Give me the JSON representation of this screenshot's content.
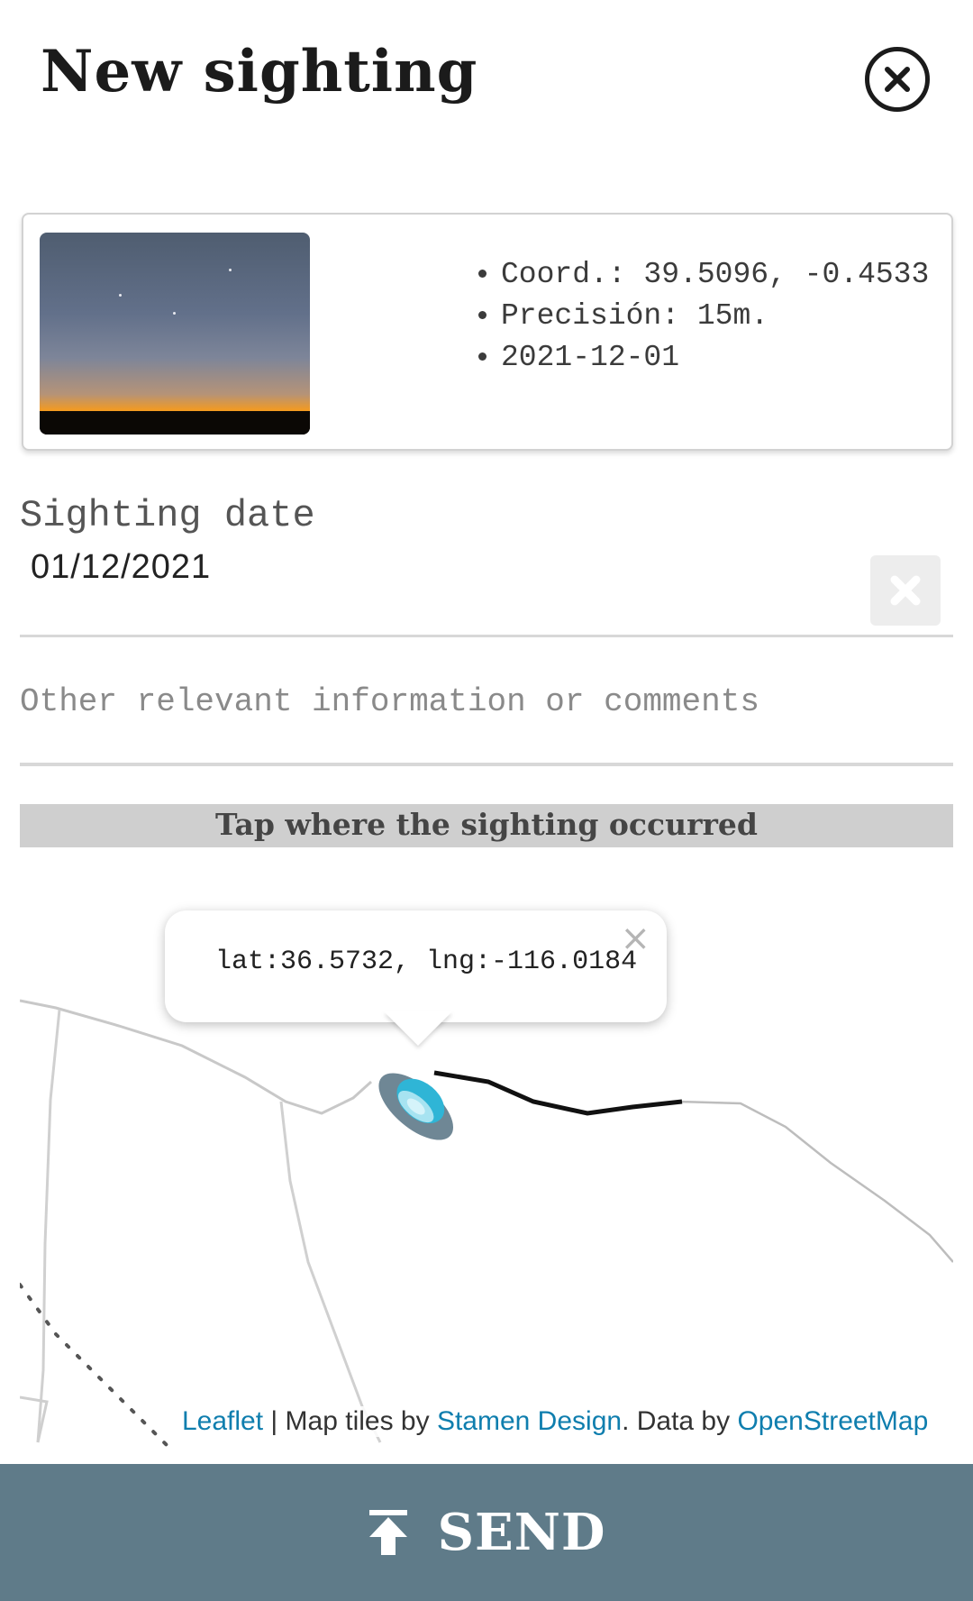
{
  "header": {
    "title": "New sighting"
  },
  "photo_card": {
    "meta": [
      "Coord.: 39.5096, -0.4533",
      "Precisión: 15m.",
      "2021-12-01"
    ]
  },
  "date_field": {
    "label": "Sighting date",
    "value": "01/12/2021"
  },
  "comments": {
    "placeholder": "Other relevant information or comments"
  },
  "map_banner": "Tap where the sighting occurred",
  "map": {
    "popup_text": "lat:36.5732, lng:-116.0184",
    "attribution": {
      "leaflet": "Leaflet",
      "sep": " | Map tiles by ",
      "stamen": "Stamen Design",
      "mid": ". Data by ",
      "osm": "OpenStreetMap"
    }
  },
  "send_button": {
    "label": "SEND"
  },
  "colors": {
    "send_bar": "#5f7b89",
    "link": "#0f7eae",
    "ufo_body": "#6f8795",
    "ufo_dome": "#2fb5d6"
  },
  "icons": {
    "close": "close-circle-icon",
    "clear": "x-icon",
    "marker": "ufo-marker-icon",
    "send": "upload-arrow-icon"
  }
}
